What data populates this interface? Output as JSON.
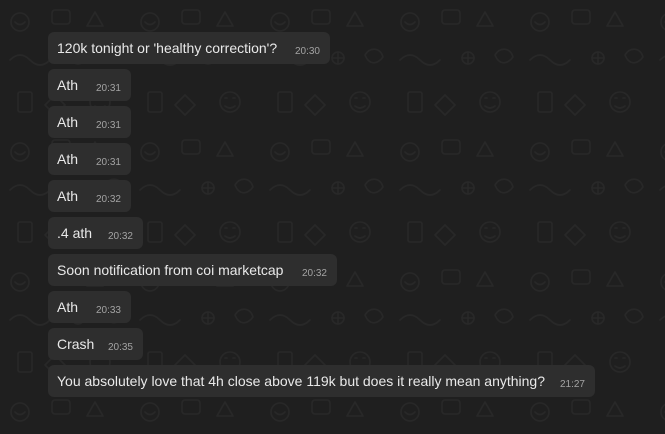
{
  "chat": {
    "messages": [
      {
        "text": "120k tonight or 'healthy correction'?",
        "time": "20:30"
      },
      {
        "text": "Ath",
        "time": "20:31"
      },
      {
        "text": "Ath",
        "time": "20:31"
      },
      {
        "text": "Ath",
        "time": "20:31"
      },
      {
        "text": "Ath",
        "time": "20:32"
      },
      {
        "text": ".4 ath",
        "time": "20:32"
      },
      {
        "text": "Soon notification from coi marketcap",
        "time": "20:32"
      },
      {
        "text": "Ath",
        "time": "20:33"
      },
      {
        "text": "Crash",
        "time": "20:35"
      },
      {
        "text": "You absolutely love that 4h close above 119k but does it really mean anything?",
        "time": "21:27"
      }
    ]
  },
  "colors": {
    "background": "#1f1f1f",
    "bubble": "#2e2e2e",
    "text": "#e9e9e9",
    "timestamp": "#a3a3a3"
  }
}
